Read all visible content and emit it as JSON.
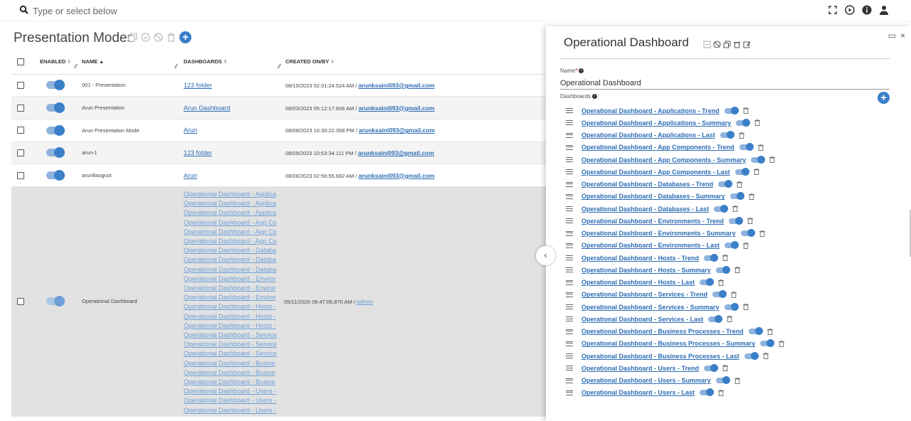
{
  "search": {
    "placeholder": "Type or select below"
  },
  "page": {
    "title": "Presentation Modes"
  },
  "table": {
    "headers": {
      "enabled": "ENABLED",
      "name": "NAME",
      "dashboards": "DASHBOARDS",
      "created": "CREATED ON/BY"
    },
    "rows": [
      {
        "name": "001 - Presentation",
        "dashboard": "123 folder",
        "created": "08/10/2023 02:31:24.524 AM / ",
        "user": "arunksaini093@gmail.com"
      },
      {
        "name": "Arun Presentation",
        "dashboard": "Arun Dashboard",
        "created": "08/03/2023 05:12:17.606 AM / ",
        "user": "arunksaini093@gmail.com"
      },
      {
        "name": "Arun Presentation Mode",
        "dashboard": "Arun",
        "created": "08/08/2023 10:30:22.358 PM / ",
        "user": "arunksaini093@gmail.com"
      },
      {
        "name": "arun-1",
        "dashboard": "123 folder",
        "created": "08/09/2023 10:53:34.111 PM / ",
        "user": "arunksaini093@gmail.com"
      },
      {
        "name": "arun8august",
        "dashboard": "Arun",
        "created": "08/08/2023 02:56:55.682 AM / ",
        "user": "arunksaini093@gmail.com"
      }
    ],
    "big_row": {
      "name": "Operational Dashboard",
      "created": "05/11/2020 06:47:06.870 AM / ",
      "user": "admin",
      "dashboards": [
        "Operational Dashboard - Applica",
        "Operational Dashboard - Applica",
        "Operational Dashboard - Applica",
        "Operational Dashboard - App Co",
        "Operational Dashboard - App Co",
        "Operational Dashboard - App Co",
        "Operational Dashboard - Databa",
        "Operational Dashboard - Databa",
        "Operational Dashboard - Databa",
        "Operational Dashboard - Enviror",
        "Operational Dashboard - Enviror",
        "Operational Dashboard - Enviror",
        "Operational Dashboard - Hosts -",
        "Operational Dashboard - Hosts -",
        "Operational Dashboard - Hosts -",
        "Operational Dashboard - Service",
        "Operational Dashboard - Service",
        "Operational Dashboard - Service",
        "Operational Dashboard - Busine",
        "Operational Dashboard - Busine",
        "Operational Dashboard - Busine",
        "Operational Dashboard - Users -",
        "Operational Dashboard - Users -",
        "Operational Dashboard - Users -"
      ]
    }
  },
  "panel": {
    "title": "Operational Dashboard",
    "name_label": "Name",
    "name_value": "Operational Dashboard",
    "dashboards_label": "Dashboards",
    "dashboards": [
      "Operational Dashboard - Applications - Trend",
      "Operational Dashboard - Applications - Summary",
      "Operational Dashboard - Applications - Last",
      "Operational Dashboard - App Components - Trend",
      "Operational Dashboard - App Components - Summary",
      "Operational Dashboard - App Components - Last",
      "Operational Dashboard - Databases - Trend",
      "Operational Dashboard - Databases - Summary",
      "Operational Dashboard - Databases - Last",
      "Operational Dashboard - Environments - Trend",
      "Operational Dashboard - Environments - Summary",
      "Operational Dashboard - Environments - Last",
      "Operational Dashboard - Hosts - Trend",
      "Operational Dashboard - Hosts - Summary",
      "Operational Dashboard - Hosts - Last",
      "Operational Dashboard - Services - Trend",
      "Operational Dashboard - Services - Summary",
      "Operational Dashboard - Services - Last",
      "Operational Dashboard - Business Processes - Trend",
      "Operational Dashboard - Business Processes - Summary",
      "Operational Dashboard - Business Processes - Last",
      "Operational Dashboard - Users - Trend",
      "Operational Dashboard - Users - Summary",
      "Operational Dashboard - Users - Last"
    ]
  },
  "colors": {
    "accent": "#3a7fc8",
    "link": "#2e6db4"
  }
}
